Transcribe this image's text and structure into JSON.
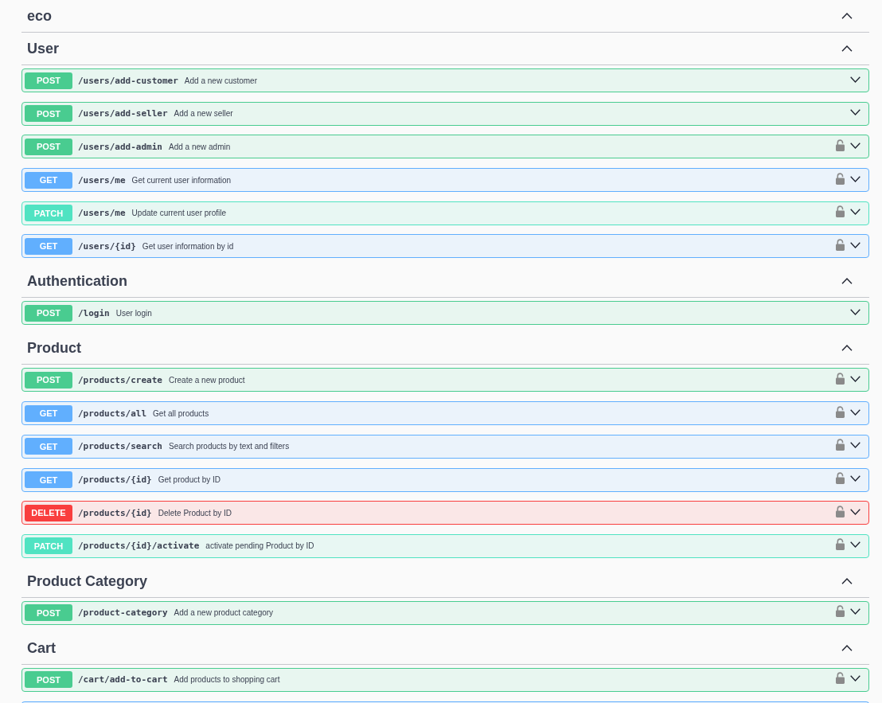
{
  "sections": [
    {
      "title": "eco",
      "expanded": true
    },
    {
      "title": "User",
      "expanded": true,
      "operations": [
        {
          "kind": "post",
          "method": "POST",
          "path": "/users/add-customer",
          "summary": "Add a new customer",
          "secured": false,
          "expanded": false
        },
        {
          "kind": "post",
          "method": "POST",
          "path": "/users/add-seller",
          "summary": "Add a new seller",
          "secured": false,
          "expanded": false
        },
        {
          "kind": "post",
          "method": "POST",
          "path": "/users/add-admin",
          "summary": "Add a new admin",
          "secured": true,
          "expanded": false
        },
        {
          "kind": "get",
          "method": "GET",
          "path": "/users/me",
          "summary": "Get current user information",
          "secured": true,
          "expanded": false
        },
        {
          "kind": "patch",
          "method": "PATCH",
          "path": "/users/me",
          "summary": "Update current user profile",
          "secured": true,
          "expanded": false
        },
        {
          "kind": "get",
          "method": "GET",
          "path": "/users/{id}",
          "summary": "Get user information by id",
          "secured": true,
          "expanded": false
        }
      ]
    },
    {
      "title": "Authentication",
      "expanded": true,
      "operations": [
        {
          "kind": "post",
          "method": "POST",
          "path": "/login",
          "summary": "User login",
          "secured": false,
          "expanded": false
        }
      ]
    },
    {
      "title": "Product",
      "expanded": true,
      "operations": [
        {
          "kind": "post",
          "method": "POST",
          "path": "/products/create",
          "summary": "Create a new product",
          "secured": true,
          "expanded": false
        },
        {
          "kind": "get",
          "method": "GET",
          "path": "/products/all",
          "summary": "Get all products",
          "secured": true,
          "expanded": false
        },
        {
          "kind": "get",
          "method": "GET",
          "path": "/products/search",
          "summary": "Search products by text and filters",
          "secured": true,
          "expanded": false
        },
        {
          "kind": "get",
          "method": "GET",
          "path": "/products/{id}",
          "summary": "Get product by ID",
          "secured": true,
          "expanded": false
        },
        {
          "kind": "delete",
          "method": "DELETE",
          "path": "/products/{id}",
          "summary": "Delete Product by ID",
          "secured": true,
          "expanded": false
        },
        {
          "kind": "patch",
          "method": "PATCH",
          "path": "/products/{id}/activate",
          "summary": "activate pending Product by ID",
          "secured": true,
          "expanded": false
        }
      ]
    },
    {
      "title": "Product Category",
      "expanded": true,
      "operations": [
        {
          "kind": "post",
          "method": "POST",
          "path": "/product-category",
          "summary": "Add a new product category",
          "secured": true,
          "expanded": false
        }
      ]
    },
    {
      "title": "Cart",
      "expanded": true,
      "operations": [
        {
          "kind": "post",
          "method": "POST",
          "path": "/cart/add-to-cart",
          "summary": "Add products to shopping cart",
          "secured": true,
          "expanded": false
        }
      ],
      "clipped_row": {
        "kind": "get"
      }
    }
  ]
}
